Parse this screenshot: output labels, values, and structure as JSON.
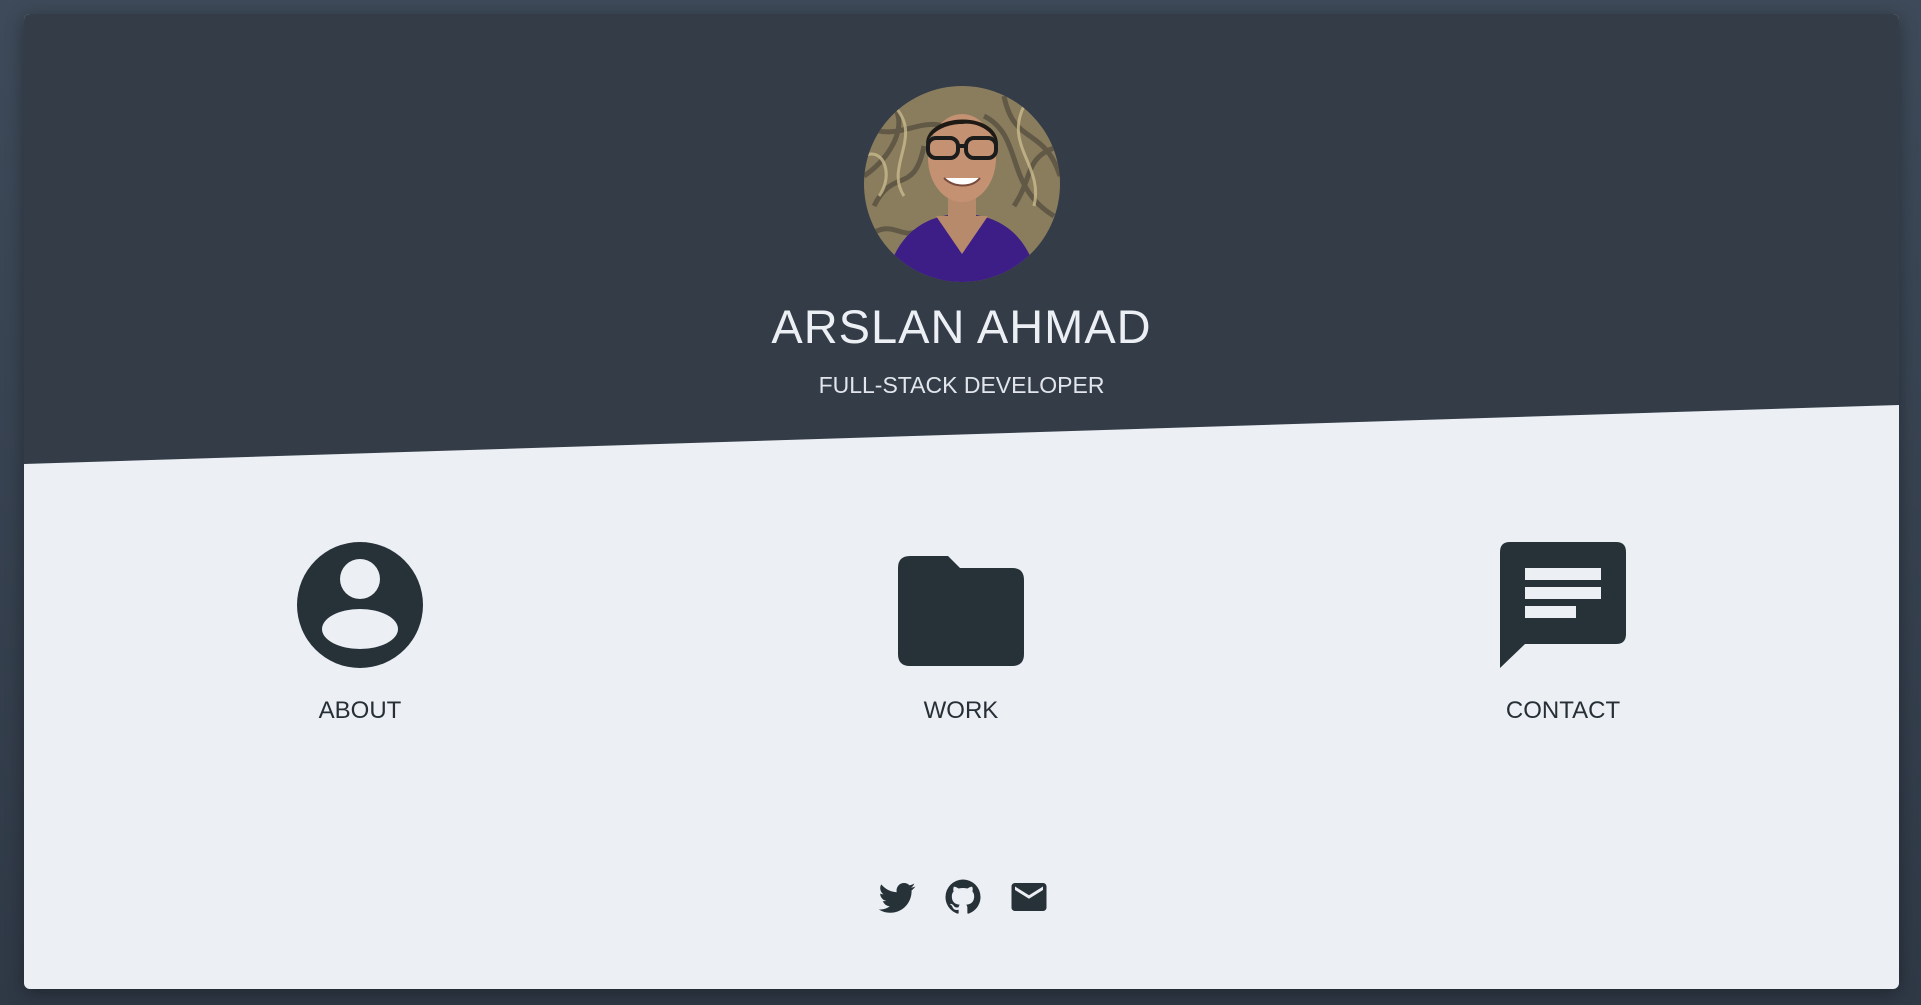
{
  "profile": {
    "name": "ARSLAN AHMAD",
    "title": "FULL-STACK DEVELOPER"
  },
  "nav": {
    "items": [
      {
        "label": "ABOUT",
        "icon": "account-circle-icon"
      },
      {
        "label": "WORK",
        "icon": "folder-icon"
      },
      {
        "label": "CONTACT",
        "icon": "chat-message-icon"
      }
    ]
  },
  "social": [
    {
      "icon": "twitter-icon"
    },
    {
      "icon": "github-icon"
    },
    {
      "icon": "email-icon"
    }
  ],
  "colors": {
    "header": "#333c47",
    "body": "#eceff4",
    "icon": "#263238",
    "frame": "#3e4a59"
  }
}
